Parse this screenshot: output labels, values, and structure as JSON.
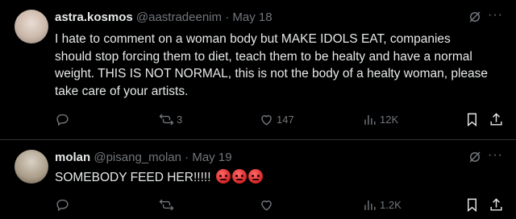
{
  "tweets": [
    {
      "display_name": "astra.kosmos",
      "handle": "@aastradeenim",
      "separator": "·",
      "date": "May 18",
      "text": "I hate to comment on a woman body but MAKE  IDOLS EAT, companies should stop forcing them to diet, teach them to be healty and have a normal weight. THIS IS NOT NORMAL, this is not the body of a healty woman, please take care of your artists.",
      "replies": "",
      "reposts": "3",
      "likes": "147",
      "views": "12K"
    },
    {
      "display_name": "molan",
      "handle": "@pisang_molan",
      "separator": "·",
      "date": "May 19",
      "text": "SOMEBODY FEED HER!!!!!",
      "emoji": [
        "angry-face",
        "angry-face",
        "angry-face"
      ],
      "replies": "",
      "reposts": "",
      "likes": "",
      "views": "1.2K"
    }
  ],
  "more_glyph": "···",
  "colors": {
    "background": "#000000",
    "text": "#e7e9ea",
    "muted": "#71767b",
    "divider": "#2f3336"
  }
}
